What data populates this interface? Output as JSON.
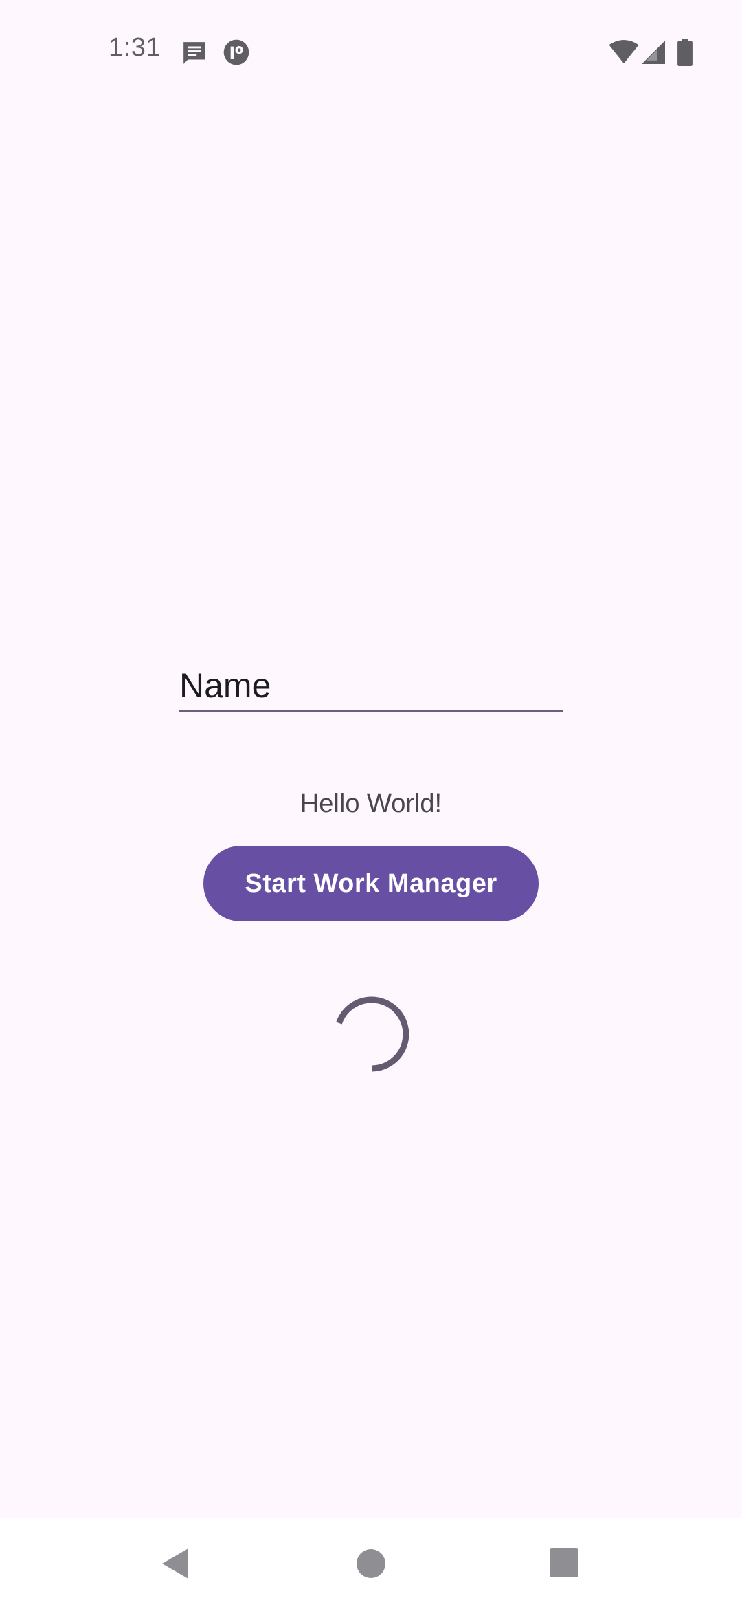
{
  "status_bar": {
    "time": "1:31",
    "icons": [
      "message-icon",
      "circle-app-icon",
      "wifi-icon",
      "cell-signal-icon",
      "battery-icon"
    ]
  },
  "form": {
    "name_value": "Name"
  },
  "greeting": "Hello World!",
  "actions": {
    "start_label": "Start Work Manager"
  },
  "progress": {
    "indeterminate": true
  },
  "nav": {
    "buttons": [
      "back-icon",
      "home-icon",
      "recents-icon"
    ]
  },
  "colors": {
    "background": "#FFF7FE",
    "primary": "#6750A4",
    "underline": "#6A5F80",
    "text": "#1C1B1F",
    "secondary_text": "#49454F",
    "status_icon": "#5F5F63",
    "nav_icon": "#8E8E93"
  }
}
